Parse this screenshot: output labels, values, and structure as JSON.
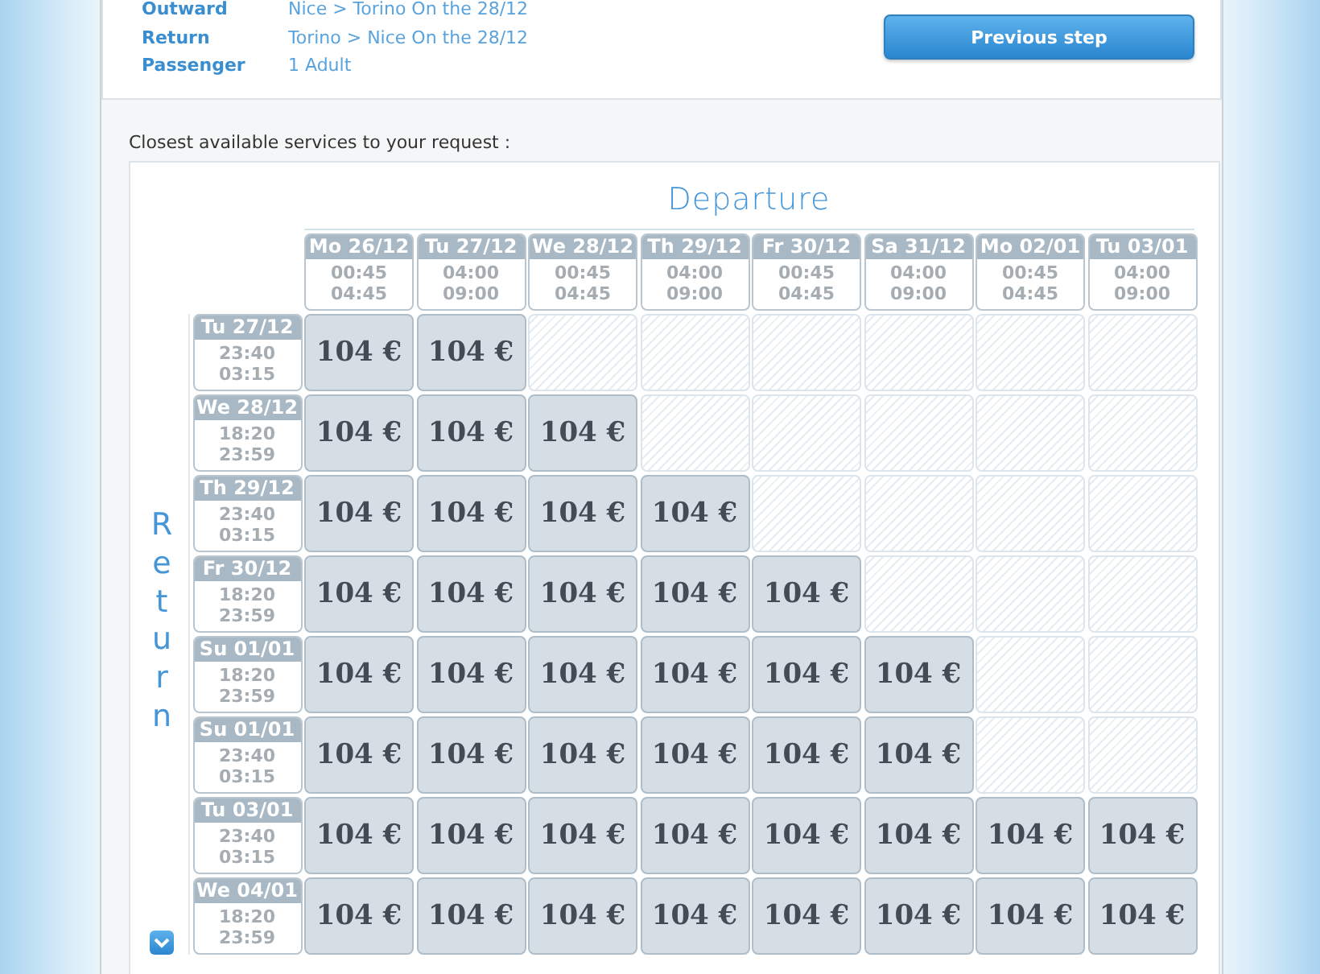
{
  "summary": [
    {
      "label": "Outward",
      "value": "Nice > Torino On the 28/12"
    },
    {
      "label": "Return",
      "value": "Torino > Nice On the 28/12"
    },
    {
      "label": "Passenger",
      "value": "1 Adult"
    }
  ],
  "previous_button": "Previous step",
  "intro": "Closest available services to your request :",
  "grid": {
    "departure_title": "Departure",
    "return_title": "Return",
    "columns": [
      {
        "date": "Mo 26/12",
        "times": [
          "00:45",
          "04:45"
        ]
      },
      {
        "date": "Tu 27/12",
        "times": [
          "04:00",
          "09:00"
        ]
      },
      {
        "date": "We 28/12",
        "times": [
          "00:45",
          "04:45"
        ]
      },
      {
        "date": "Th 29/12",
        "times": [
          "04:00",
          "09:00"
        ]
      },
      {
        "date": "Fr 30/12",
        "times": [
          "00:45",
          "04:45"
        ]
      },
      {
        "date": "Sa 31/12",
        "times": [
          "04:00",
          "09:00"
        ]
      },
      {
        "date": "Mo 02/01",
        "times": [
          "00:45",
          "04:45"
        ]
      },
      {
        "date": "Tu 03/01",
        "times": [
          "04:00",
          "09:00"
        ]
      }
    ],
    "rows": [
      {
        "date": "Tu 27/12",
        "times": [
          "23:40",
          "03:15"
        ],
        "cells": [
          {
            "kind": "price",
            "text": "104 €"
          },
          {
            "kind": "price",
            "text": "104 €"
          },
          {
            "kind": "empty"
          },
          {
            "kind": "empty"
          },
          {
            "kind": "empty"
          },
          {
            "kind": "empty"
          },
          {
            "kind": "empty"
          },
          {
            "kind": "empty"
          }
        ]
      },
      {
        "date": "We 28/12",
        "times": [
          "18:20",
          "23:59"
        ],
        "cells": [
          {
            "kind": "price",
            "text": "104 €"
          },
          {
            "kind": "price",
            "text": "104 €"
          },
          {
            "kind": "price",
            "text": "104 €"
          },
          {
            "kind": "empty"
          },
          {
            "kind": "empty"
          },
          {
            "kind": "empty"
          },
          {
            "kind": "empty"
          },
          {
            "kind": "empty"
          }
        ]
      },
      {
        "date": "Th 29/12",
        "times": [
          "23:40",
          "03:15"
        ],
        "cells": [
          {
            "kind": "price",
            "text": "104 €"
          },
          {
            "kind": "price",
            "text": "104 €"
          },
          {
            "kind": "price",
            "text": "104 €"
          },
          {
            "kind": "price",
            "text": "104 €"
          },
          {
            "kind": "empty"
          },
          {
            "kind": "empty"
          },
          {
            "kind": "empty"
          },
          {
            "kind": "empty"
          }
        ]
      },
      {
        "date": "Fr 30/12",
        "times": [
          "18:20",
          "23:59"
        ],
        "cells": [
          {
            "kind": "price",
            "text": "104 €"
          },
          {
            "kind": "price",
            "text": "104 €"
          },
          {
            "kind": "price",
            "text": "104 €"
          },
          {
            "kind": "price",
            "text": "104 €"
          },
          {
            "kind": "price",
            "text": "104 €"
          },
          {
            "kind": "empty"
          },
          {
            "kind": "empty"
          },
          {
            "kind": "empty"
          }
        ]
      },
      {
        "date": "Su 01/01",
        "times": [
          "18:20",
          "23:59"
        ],
        "cells": [
          {
            "kind": "price",
            "text": "104 €"
          },
          {
            "kind": "price",
            "text": "104 €"
          },
          {
            "kind": "price",
            "text": "104 €"
          },
          {
            "kind": "price",
            "text": "104 €"
          },
          {
            "kind": "price",
            "text": "104 €"
          },
          {
            "kind": "price",
            "text": "104 €"
          },
          {
            "kind": "empty"
          },
          {
            "kind": "empty"
          }
        ]
      },
      {
        "date": "Su 01/01",
        "times": [
          "23:40",
          "03:15"
        ],
        "cells": [
          {
            "kind": "price",
            "text": "104 €"
          },
          {
            "kind": "price",
            "text": "104 €"
          },
          {
            "kind": "price",
            "text": "104 €"
          },
          {
            "kind": "price",
            "text": "104 €"
          },
          {
            "kind": "price",
            "text": "104 €"
          },
          {
            "kind": "price",
            "text": "104 €"
          },
          {
            "kind": "empty"
          },
          {
            "kind": "empty"
          }
        ]
      },
      {
        "date": "Tu 03/01",
        "times": [
          "23:40",
          "03:15"
        ],
        "cells": [
          {
            "kind": "price",
            "text": "104 €"
          },
          {
            "kind": "price",
            "text": "104 €"
          },
          {
            "kind": "price",
            "text": "104 €"
          },
          {
            "kind": "price",
            "text": "104 €"
          },
          {
            "kind": "price",
            "text": "104 €"
          },
          {
            "kind": "price",
            "text": "104 €"
          },
          {
            "kind": "price",
            "text": "104 €"
          },
          {
            "kind": "price",
            "text": "104 €"
          }
        ]
      },
      {
        "date": "We 04/01",
        "times": [
          "18:20",
          "23:59"
        ],
        "cells": [
          {
            "kind": "price",
            "text": "104 €"
          },
          {
            "kind": "price",
            "text": "104 €"
          },
          {
            "kind": "price",
            "text": "104 €"
          },
          {
            "kind": "price",
            "text": "104 €"
          },
          {
            "kind": "price",
            "text": "104 €"
          },
          {
            "kind": "price",
            "text": "104 €"
          },
          {
            "kind": "price",
            "text": "104 €"
          },
          {
            "kind": "price",
            "text": "104 €"
          }
        ]
      }
    ]
  }
}
